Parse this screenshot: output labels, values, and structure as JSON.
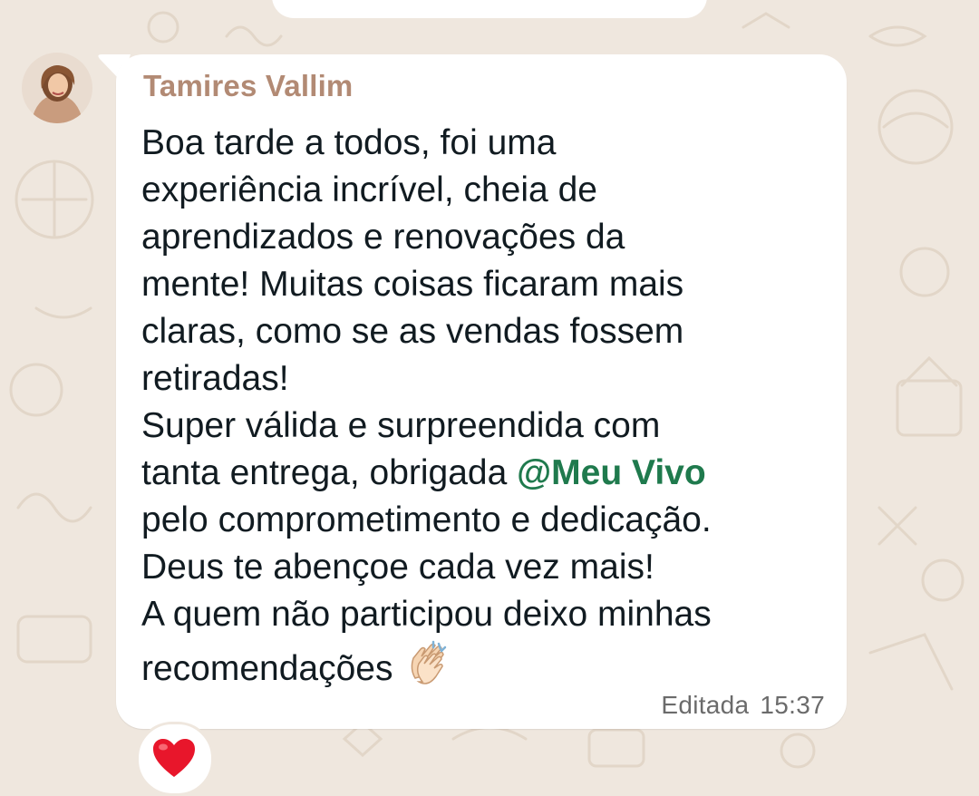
{
  "chat": {
    "sender_name": "Tamires Vallim",
    "message_part1": "Boa tarde a todos, foi uma\nexperiência incrível, cheia de\naprendizados e renovações da\nmente! Muitas coisas ficaram mais\nclaras, como se as vendas fossem\nretiradas!\nSuper válida e surpreendida com\ntanta entrega, obrigada ",
    "mention": "@Meu Vivo",
    "message_part2": "\npelo comprometimento e dedicação.\nDeus te abençoe cada vez mais!\nA quem não participou deixo minhas\nrecomendações",
    "emoji_icon": "clapping-hands-icon",
    "edited_label": "Editada",
    "time": "15:37",
    "reaction_icon": "red-heart-icon"
  },
  "colors": {
    "wallpaper": "#efe7de",
    "bubble": "#ffffff",
    "sender_name": "#b28a74",
    "mention": "#1f7a4d",
    "text": "#111b21",
    "meta": "#6b6b6b",
    "heart": "#e8162b"
  }
}
